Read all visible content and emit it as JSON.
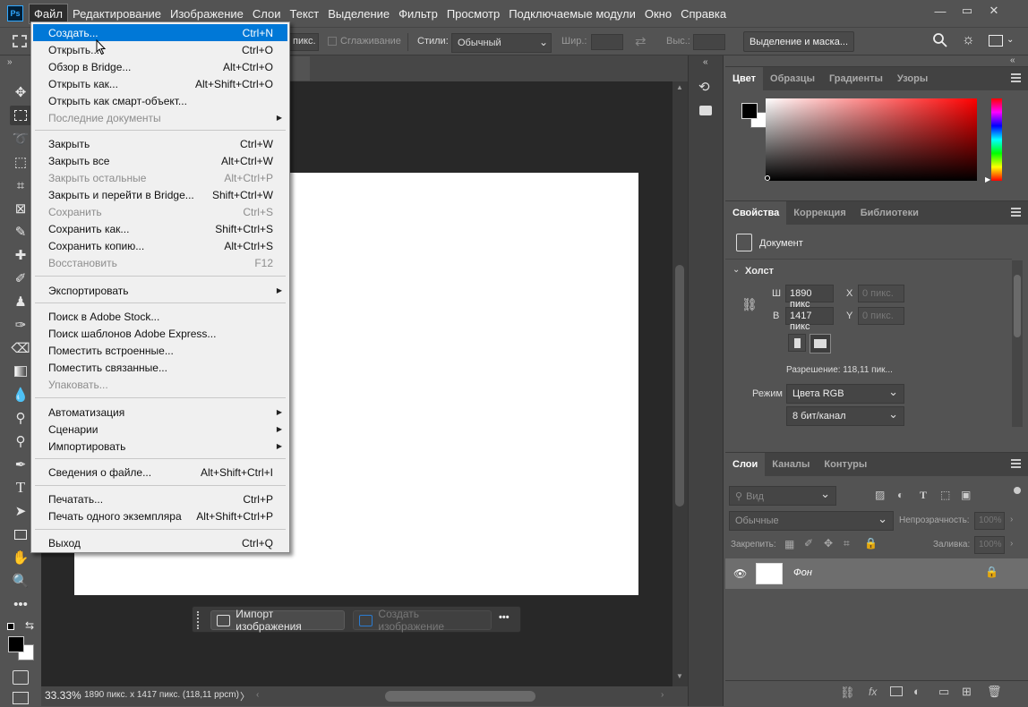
{
  "app": {
    "logo_text": "Ps"
  },
  "menubar": {
    "items": [
      "Файл",
      "Редактирование",
      "Изображение",
      "Слои",
      "Текст",
      "Выделение",
      "Фильтр",
      "Просмотр",
      "Подключаемые модули",
      "Окно",
      "Справка"
    ],
    "window_controls": {
      "minimize": "—",
      "restore": "▭",
      "close": "✕"
    }
  },
  "optbar": {
    "feather_value": "пикс.",
    "antialias_label": "Сглаживание",
    "style_label": "Стили:",
    "style_value": "Обычный",
    "width_label": "Шир.:",
    "height_label": "Выс.:",
    "select_mask_label": "Выделение и маска..."
  },
  "file_menu": {
    "items": [
      {
        "label": "Создать...",
        "shortcut": "Ctrl+N",
        "highlight": true
      },
      {
        "label": "Открыть...",
        "shortcut": "Ctrl+O"
      },
      {
        "label": "Обзор в Bridge...",
        "shortcut": "Alt+Ctrl+O"
      },
      {
        "label": "Открыть как...",
        "shortcut": "Alt+Shift+Ctrl+O"
      },
      {
        "label": "Открыть как смарт-объект...",
        "shortcut": ""
      },
      {
        "label": "Последние документы",
        "shortcut": "",
        "disabled": true,
        "submenu": true
      },
      {
        "label": "Закрыть",
        "shortcut": "Ctrl+W"
      },
      {
        "label": "Закрыть все",
        "shortcut": "Alt+Ctrl+W"
      },
      {
        "label": "Закрыть остальные",
        "shortcut": "Alt+Ctrl+P",
        "disabled": true
      },
      {
        "label": "Закрыть и перейти в Bridge...",
        "shortcut": "Shift+Ctrl+W"
      },
      {
        "label": "Сохранить",
        "shortcut": "Ctrl+S",
        "disabled": true
      },
      {
        "label": "Сохранить как...",
        "shortcut": "Shift+Ctrl+S"
      },
      {
        "label": "Сохранить копию...",
        "shortcut": "Alt+Ctrl+S"
      },
      {
        "label": "Восстановить",
        "shortcut": "F12",
        "disabled": true
      },
      {
        "label": "Экспортировать",
        "shortcut": "",
        "submenu": true
      },
      {
        "label": "Поиск в Adobe Stock...",
        "shortcut": ""
      },
      {
        "label": "Поиск шаблонов Adobe Express...",
        "shortcut": ""
      },
      {
        "label": "Поместить встроенные...",
        "shortcut": ""
      },
      {
        "label": "Поместить связанные...",
        "shortcut": ""
      },
      {
        "label": "Упаковать...",
        "shortcut": "",
        "disabled": true
      },
      {
        "label": "Автоматизация",
        "shortcut": "",
        "submenu": true
      },
      {
        "label": "Сценарии",
        "shortcut": "",
        "submenu": true
      },
      {
        "label": "Импортировать",
        "shortcut": "",
        "submenu": true
      },
      {
        "label": "Сведения о файле...",
        "shortcut": "Alt+Shift+Ctrl+I"
      },
      {
        "label": "Печатать...",
        "shortcut": "Ctrl+P"
      },
      {
        "label": "Печать одного экземпляра",
        "shortcut": "Alt+Shift+Ctrl+P"
      },
      {
        "label": "Выход",
        "shortcut": "Ctrl+Q"
      }
    ]
  },
  "contextbar": {
    "import_label": "Импорт изображения",
    "generate_label": "Создать изображение",
    "more": "•••"
  },
  "statusbar": {
    "zoom": "33.33%",
    "doc_info": "1890 пикс. x 1417 пикс. (118,11 ppcm)",
    "arrow": "〉"
  },
  "color_panel": {
    "tabs": [
      "Цвет",
      "Образцы",
      "Градиенты",
      "Узоры"
    ],
    "foreground": "#000000",
    "background": "#ffffff",
    "hue_color": "#ff0000"
  },
  "properties_panel": {
    "tabs": [
      "Свойства",
      "Коррекция",
      "Библиотеки"
    ],
    "doc_label": "Документ",
    "canvas_section": "Холст",
    "w_label": "Ш",
    "w_value": "1890 пикс",
    "h_label": "В",
    "h_value": "1417 пикс",
    "x_label": "X",
    "x_placeholder": "0 пикс.",
    "y_label": "Y",
    "y_placeholder": "0 пикс.",
    "resolution": "Разрешение: 118,11 пик...",
    "mode_label": "Режим",
    "mode_value": "Цвета RGB",
    "depth_value": "8 бит/канал"
  },
  "layers_panel": {
    "tabs": [
      "Слои",
      "Каналы",
      "Контуры"
    ],
    "search_placeholder": "Вид",
    "blend_mode": "Обычные",
    "opacity_label": "Непрозрачность:",
    "opacity_value": "100%",
    "lock_label": "Закрепить:",
    "fill_label": "Заливка:",
    "fill_value": "100%",
    "layer_name": "Фон"
  }
}
